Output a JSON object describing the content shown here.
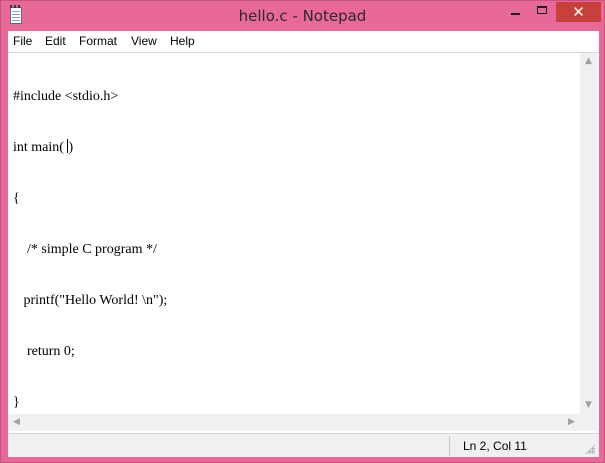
{
  "window": {
    "title": "hello.c - Notepad",
    "icon": "notepad-icon",
    "controls": {
      "close_label": "✕"
    }
  },
  "menu": [
    "File",
    "Edit",
    "Format",
    "View",
    "Help"
  ],
  "editor": {
    "lines": [
      "#include <stdio.h>",
      "int main( )",
      "{",
      "    /* simple C program */",
      "   printf(\"Hello World! \\n\");",
      "    return 0;",
      "}"
    ]
  },
  "status": {
    "position": "Ln 2, Col 11"
  },
  "colors": {
    "frame": "#e9689a",
    "close": "#c7403a",
    "chrome": "#f0f0f0"
  }
}
